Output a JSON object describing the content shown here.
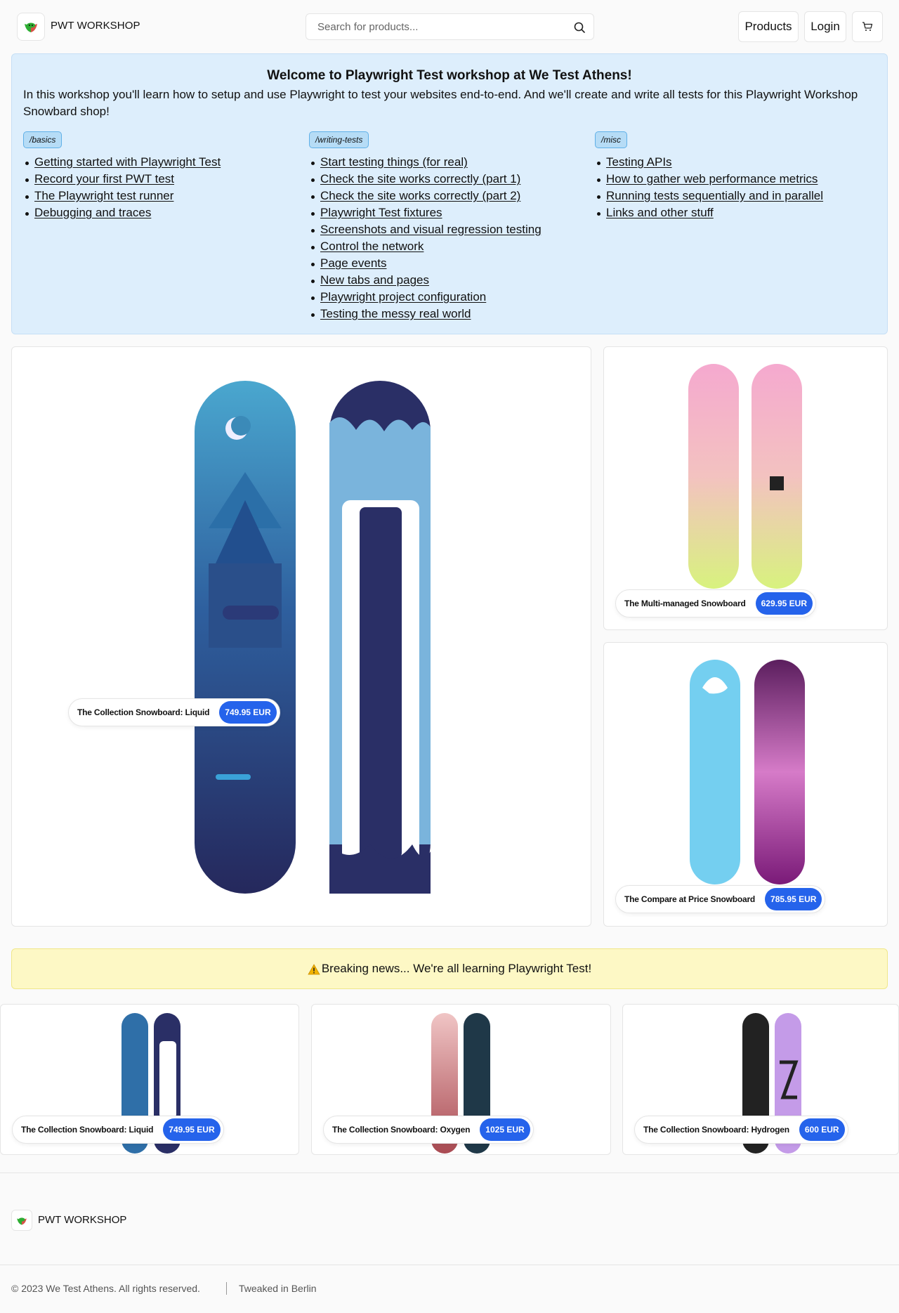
{
  "header": {
    "brand": "PWT WORKSHOP",
    "search_placeholder": "Search for products...",
    "nav_products": "Products",
    "nav_login": "Login"
  },
  "welcome": {
    "title": "Welcome to Playwright Test workshop at We Test Athens!",
    "intro": "In this workshop you'll learn how to setup and use Playwright to test your websites end-to-end. And we'll create and write all tests for this Playwright Workshop Snowbard shop!",
    "sections": [
      {
        "tag": "/basics",
        "links": [
          "Getting started with Playwright Test",
          "Record your first PWT test",
          "The Playwright test runner",
          "Debugging and traces"
        ]
      },
      {
        "tag": "/writing-tests",
        "links": [
          "Start testing things (for real)",
          "Check the site works correctly (part 1)",
          "Check the site works correctly (part 2)",
          "Playwright Test fixtures",
          "Screenshots and visual regression testing",
          "Control the network",
          "Page events",
          "New tabs and pages",
          "Playwright project configuration",
          "Testing the messy real world"
        ]
      },
      {
        "tag": "/misc",
        "links": [
          "Testing APIs",
          "How to gather web performance metrics",
          "Running tests sequentially and in parallel",
          "Links and other stuff"
        ]
      }
    ]
  },
  "featured": [
    {
      "name": "The Collection Snowboard: Liquid",
      "price": "749.95 EUR"
    },
    {
      "name": "The Multi-managed Snowboard",
      "price": "629.95 EUR"
    },
    {
      "name": "The Compare at Price Snowboard",
      "price": "785.95 EUR"
    }
  ],
  "banner": {
    "text": "Breaking news... We're all learning Playwright Test!"
  },
  "products": [
    {
      "name": "The Collection Snowboard: Liquid",
      "price": "749.95 EUR"
    },
    {
      "name": "The Collection Snowboard: Oxygen",
      "price": "1025 EUR"
    },
    {
      "name": "The Collection Snowboard: Hydrogen",
      "price": "600 EUR"
    }
  ],
  "footer": {
    "brand": "PWT WORKSHOP",
    "copyright": "© 2023 We Test Athens. All rights reserved.",
    "tweaked": "Tweaked in Berlin"
  },
  "colors": {
    "accent": "#2563eb",
    "welcome_bg": "#ddeefc",
    "banner_bg": "#fdf8c5"
  }
}
